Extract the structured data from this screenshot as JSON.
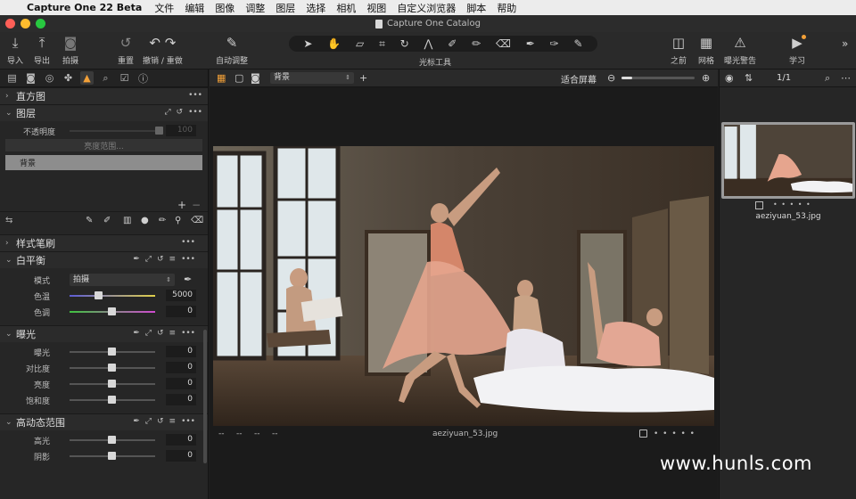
{
  "menubar": {
    "app_name": "Capture One 22 Beta",
    "items": [
      "文件",
      "编辑",
      "图像",
      "调整",
      "图层",
      "选择",
      "相机",
      "视图",
      "自定义浏览器",
      "脚本",
      "帮助"
    ]
  },
  "window": {
    "title": "Capture One Catalog"
  },
  "toolbar": {
    "import": "导入",
    "export": "导出",
    "capture": "拍摄",
    "reset": "重置",
    "undo_redo": "撤销 / 重做",
    "auto_adjust": "自动调整",
    "cursor_tools": "光标工具",
    "before": "之前",
    "grid": "网格",
    "exposure_warning": "曝光警告",
    "learn": "学习"
  },
  "left_panel": {
    "histogram": {
      "title": "直方图"
    },
    "layers": {
      "title": "图层",
      "opacity_label": "不透明度",
      "opacity_value": "100",
      "luma_range_button": "亮度范围...",
      "layer_name": "背景"
    },
    "styles": {
      "title": "样式笔刷"
    },
    "white_balance": {
      "title": "白平衡",
      "mode_label": "模式",
      "mode_value": "拍摄",
      "temp_label": "色温",
      "temp_value": "5000",
      "tint_label": "色调",
      "tint_value": "0"
    },
    "exposure": {
      "title": "曝光",
      "rows": [
        {
          "label": "曝光",
          "value": "0"
        },
        {
          "label": "对比度",
          "value": "0"
        },
        {
          "label": "亮度",
          "value": "0"
        },
        {
          "label": "饱和度",
          "value": "0"
        }
      ]
    },
    "hdr": {
      "title": "高动态范围",
      "rows": [
        {
          "label": "高光",
          "value": "0"
        },
        {
          "label": "阴影",
          "value": "0"
        }
      ]
    }
  },
  "viewer": {
    "layer_select": "背景",
    "fit_label": "适合屏幕",
    "zoom_level": 0.15,
    "footer_meta": [
      "--",
      "--",
      "--",
      "--"
    ],
    "filename": "aeziyuan_53.jpg",
    "rating_dots": "• • • • •"
  },
  "right_panel": {
    "count": "1/1",
    "thumb_name": "aeziyuan_53.jpg",
    "rating_dots": "• • • • •"
  },
  "watermark": "www.hunls.com",
  "colors": {
    "accent": "#f2a038",
    "panel": "#262626",
    "menubar": "#ececec"
  }
}
